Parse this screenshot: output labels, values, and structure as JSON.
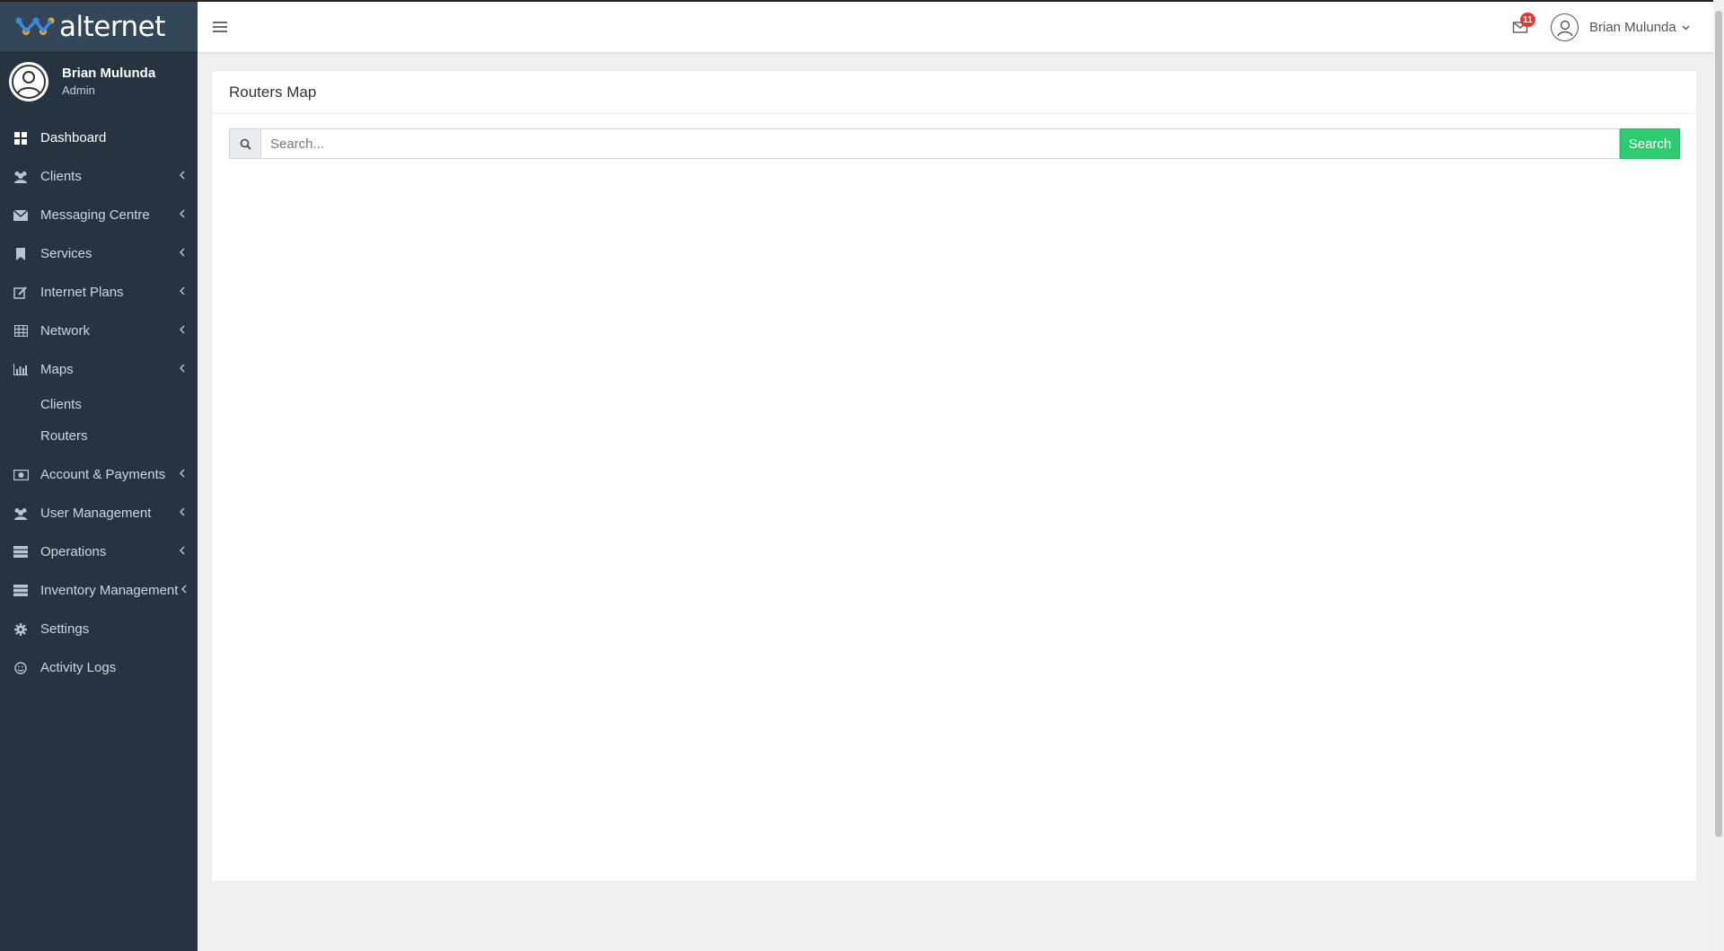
{
  "brand": {
    "name": "alternet"
  },
  "user": {
    "name": "Brian Mulunda",
    "role": "Admin"
  },
  "sidebar": {
    "items": [
      {
        "label": "Dashboard",
        "icon": "dashboard-icon",
        "active": true,
        "has_children": false
      },
      {
        "label": "Clients",
        "icon": "users-icon",
        "has_children": true
      },
      {
        "label": "Messaging Centre",
        "icon": "envelope-icon",
        "has_children": true
      },
      {
        "label": "Services",
        "icon": "bookmark-icon",
        "has_children": true
      },
      {
        "label": "Internet Plans",
        "icon": "edit-icon",
        "has_children": true
      },
      {
        "label": "Network",
        "icon": "table-icon",
        "has_children": true
      },
      {
        "label": "Maps",
        "icon": "bar-chart-icon",
        "has_children": true,
        "expanded": true,
        "children": [
          {
            "label": "Clients"
          },
          {
            "label": "Routers"
          }
        ]
      },
      {
        "label": "Account & Payments",
        "icon": "money-icon",
        "has_children": true
      },
      {
        "label": "User Management",
        "icon": "users-icon",
        "has_children": true
      },
      {
        "label": "Operations",
        "icon": "server-icon",
        "has_children": true
      },
      {
        "label": "Inventory Management",
        "icon": "server-icon",
        "has_children": true
      },
      {
        "label": "Settings",
        "icon": "gear-icon",
        "has_children": false
      },
      {
        "label": "Activity Logs",
        "icon": "smile-icon",
        "has_children": false
      }
    ]
  },
  "topbar": {
    "mail_badge": "11",
    "user_name": "Brian Mulunda"
  },
  "main": {
    "title": "Routers Map",
    "search": {
      "placeholder": "Search...",
      "value": "",
      "button_label": "Search"
    }
  },
  "colors": {
    "sidebar_bg": "#263442",
    "brand_bg": "#344758",
    "accent_green": "#2ecc71",
    "badge_red": "#e53935",
    "logo_blue": "#3a8be0",
    "logo_orange": "#f5a623"
  }
}
